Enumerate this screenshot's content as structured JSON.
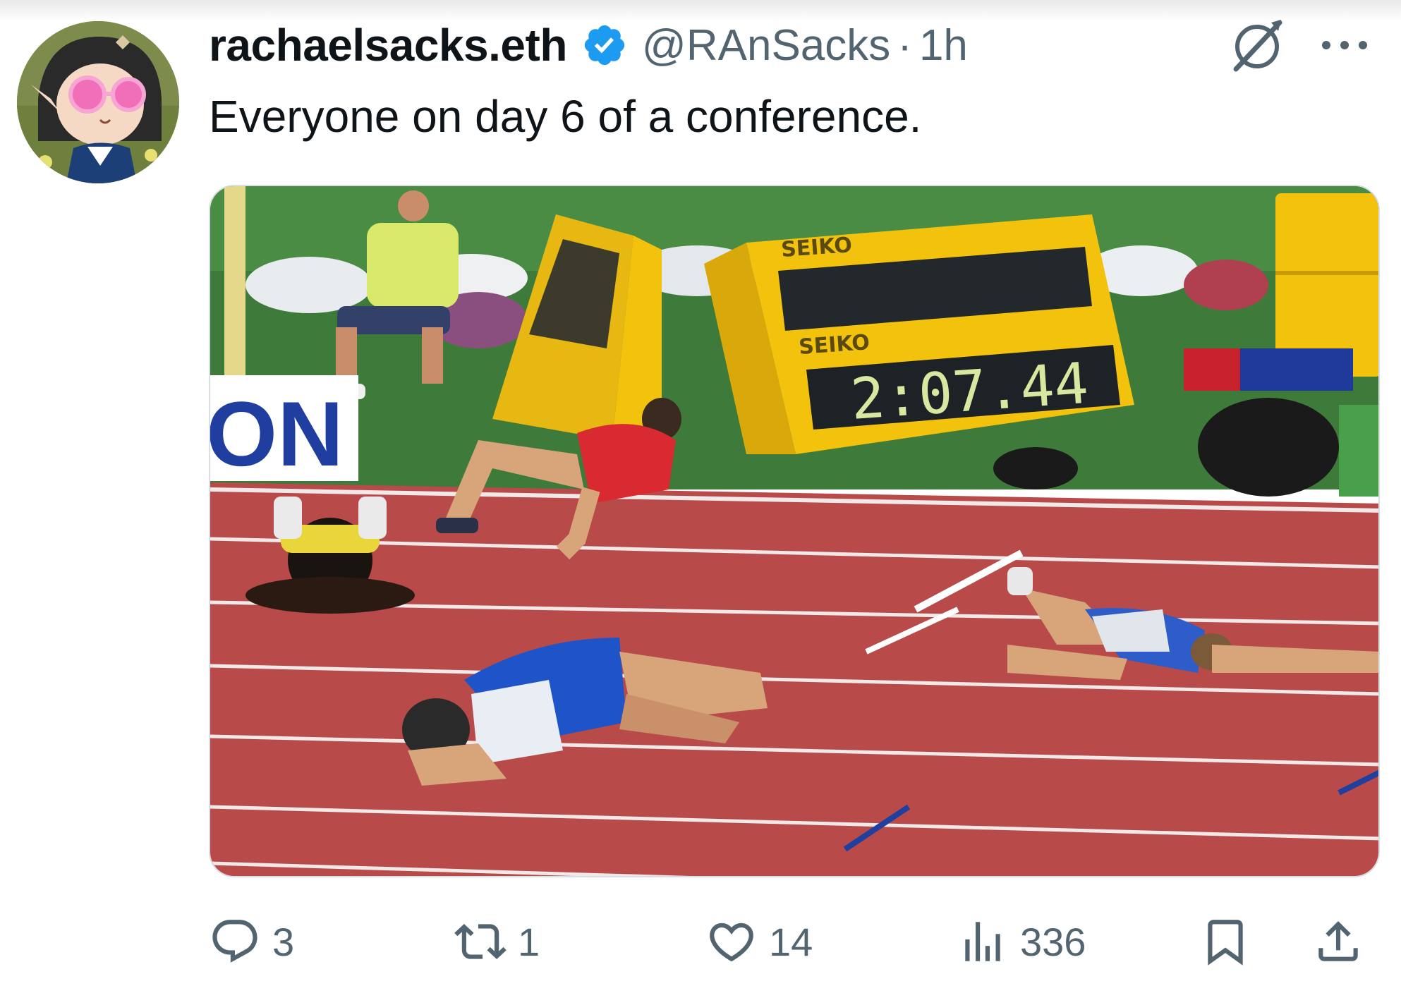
{
  "author": {
    "display_name": "rachaelsacks.eth",
    "handle": "@RAnSacks",
    "separator": "·",
    "time": "1h",
    "verified": true,
    "verified_color": "#1d9bf0"
  },
  "tweet": {
    "text": "Everyone on day 6 of a conference."
  },
  "media": {
    "board_top_brand": "SEIKO",
    "board_bottom_brand": "SEIKO",
    "clock": "2:07.44",
    "banner_text": "ON"
  },
  "actions": {
    "replies": "3",
    "retweets": "1",
    "likes": "14",
    "views": "336"
  },
  "icons": [
    "grok-icon",
    "more-icon",
    "reply-icon",
    "retweet-icon",
    "like-icon",
    "views-icon",
    "bookmark-icon",
    "share-icon"
  ],
  "colors": {
    "text_primary": "#0f1419",
    "text_secondary": "#536471",
    "track_red": "#b84a4a",
    "scoreboard_yellow": "#f2c20d"
  }
}
